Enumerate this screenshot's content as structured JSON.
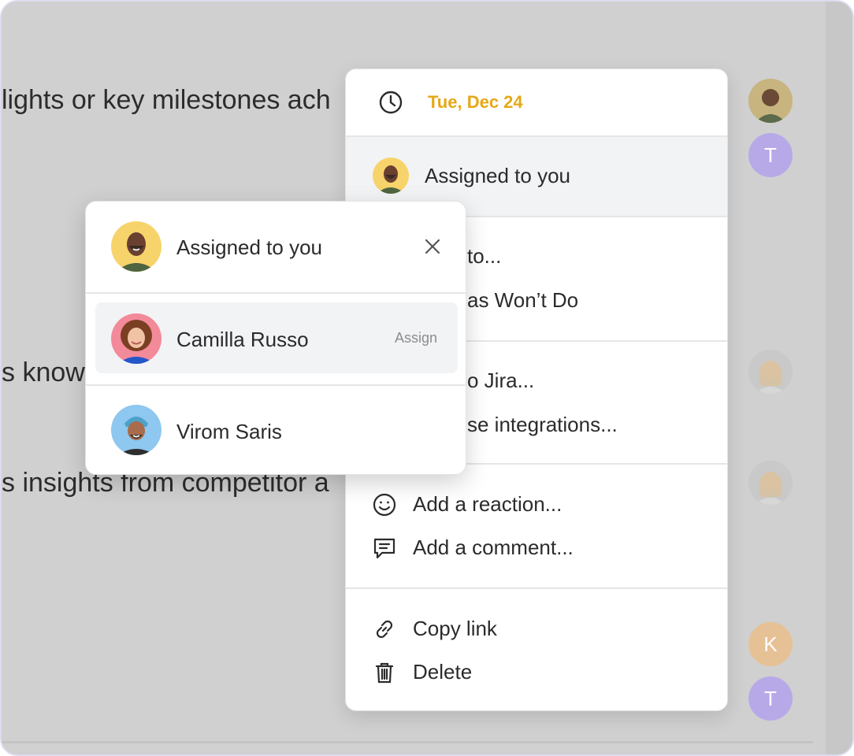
{
  "background": {
    "lines": [
      "lights or key milestones ach",
      "s know",
      "s insights from competitor a"
    ],
    "avatar_letters": {
      "t1": "T",
      "k": "K",
      "t2": "T"
    }
  },
  "menu": {
    "date_label": "Tue, Dec 24",
    "assigned_label": "Assigned to you",
    "partial_items": {
      "move_to": "to...",
      "mark_wont_do": "as Won’t Do",
      "send_jira": "o Jira...",
      "browse_integrations": "se integrations..."
    },
    "add_reaction": "Add a reaction...",
    "add_comment": "Add a comment...",
    "copy_link": "Copy link",
    "delete": "Delete"
  },
  "assign_popover": {
    "current": "Assigned to you",
    "options": [
      {
        "name": "Camilla Russo",
        "action": "Assign"
      },
      {
        "name": "Virom Saris",
        "action": ""
      }
    ]
  },
  "colors": {
    "accent_date": "#e6a817",
    "avatar_purple": "#b7a9e8",
    "avatar_orange": "#f5c499",
    "avatar_yellow": "#f7d36b"
  }
}
